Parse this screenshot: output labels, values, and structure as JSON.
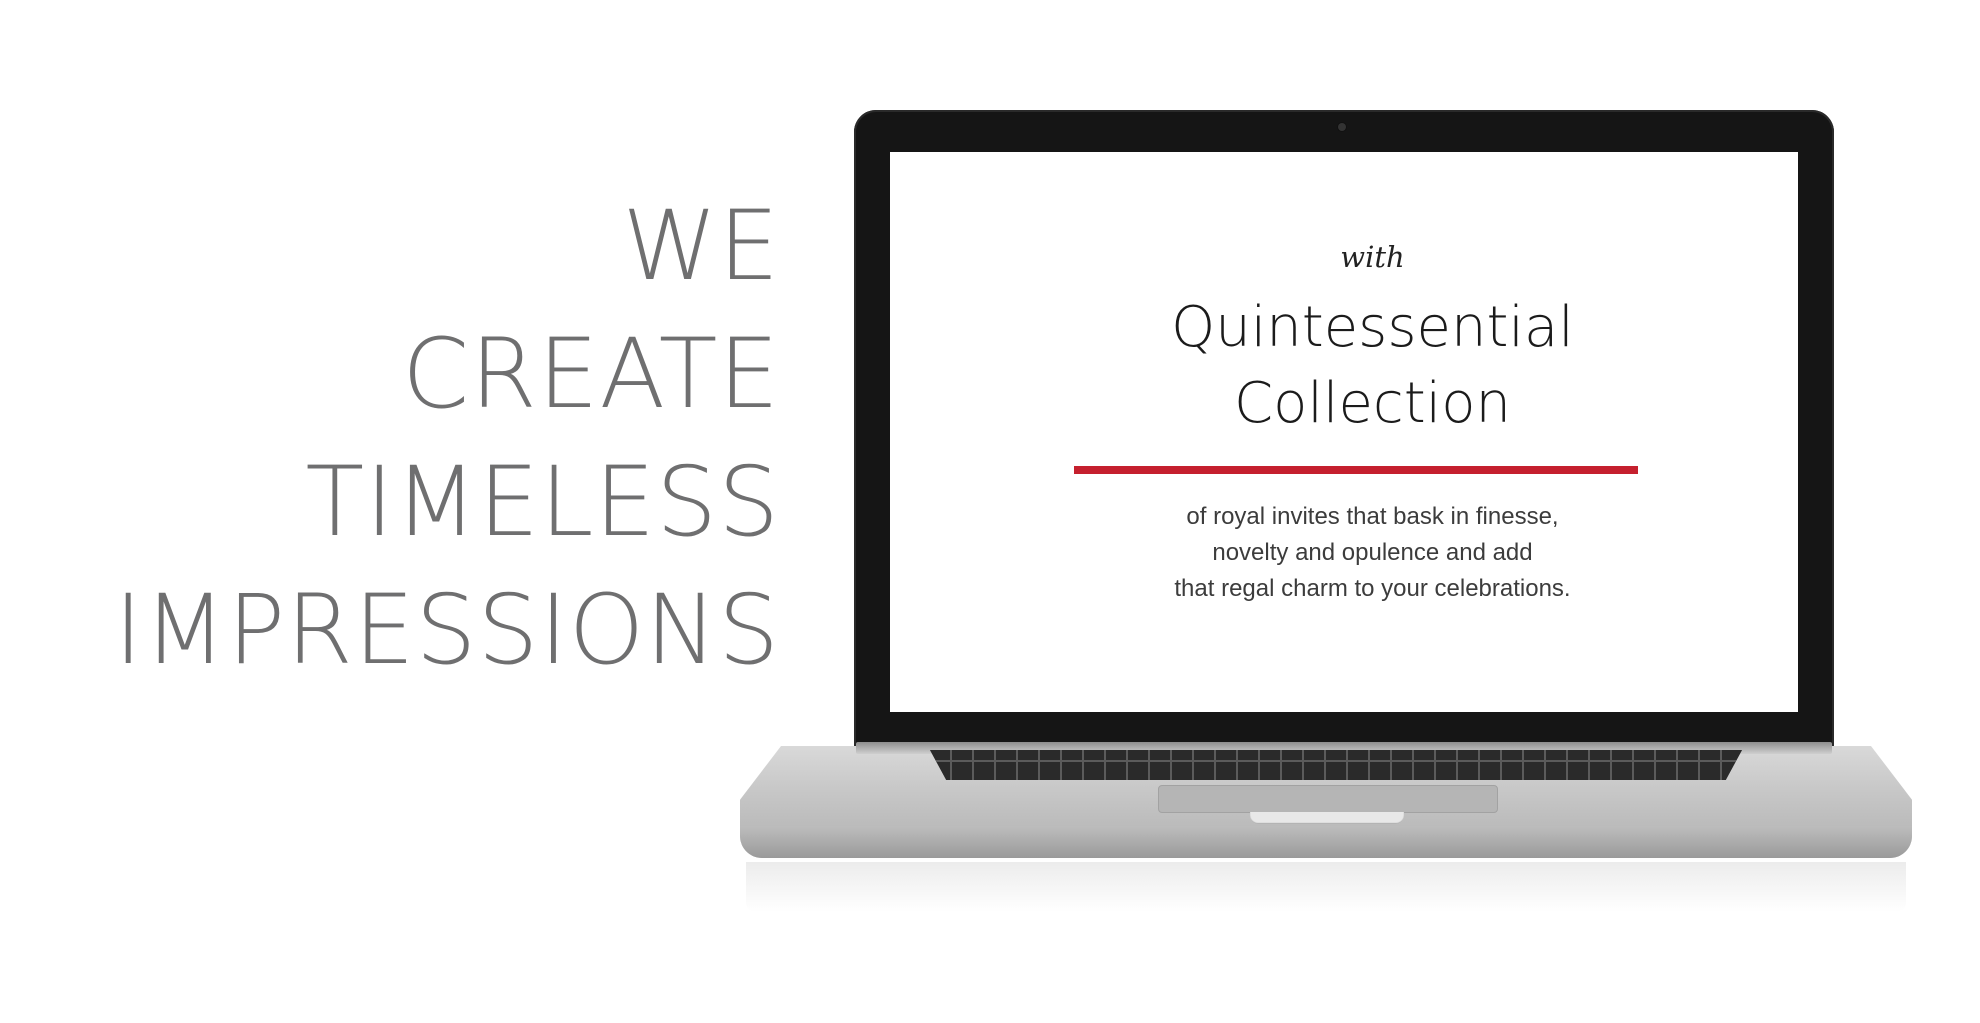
{
  "headline": {
    "lines": [
      "WE",
      "CREATE",
      "TIMELESS",
      "IMPRESSIONS"
    ]
  },
  "screen": {
    "with": "with",
    "title_line_1": "Quintessential",
    "title_line_2": "Collection",
    "body_line_1": "of royal invites that bask in finesse,",
    "body_line_2": "novelty and opulence and add",
    "body_line_3": "that regal charm to your celebrations."
  },
  "colors": {
    "headline": "#6f6f70",
    "accent_rule": "#c5202e",
    "laptop_bezel": "#151515",
    "laptop_body": "#c7c7c7"
  }
}
